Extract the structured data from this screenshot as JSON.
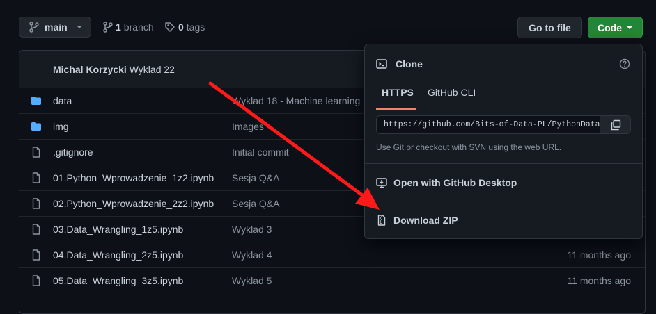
{
  "toolbar": {
    "branch_name": "main",
    "branch_count": "1",
    "branch_label": "branch",
    "tag_count": "0",
    "tag_label": "tags",
    "goto_file": "Go to file",
    "code_label": "Code"
  },
  "commit": {
    "author": "Michal Korzycki",
    "message": "Wyklad 22"
  },
  "files": [
    {
      "type": "folder",
      "name": "data",
      "message": "Wyklad 18 - Machine learning",
      "time": ""
    },
    {
      "type": "folder",
      "name": "img",
      "message": "Images",
      "time": ""
    },
    {
      "type": "file",
      "name": ".gitignore",
      "message": "Initial commit",
      "time": ""
    },
    {
      "type": "file",
      "name": "01.Python_Wprowadzenie_1z2.ipynb",
      "message": "Sesja Q&A",
      "time": ""
    },
    {
      "type": "file",
      "name": "02.Python_Wprowadzenie_2z2.ipynb",
      "message": "Sesja Q&A",
      "time": ""
    },
    {
      "type": "file",
      "name": "03.Data_Wrangling_1z5.ipynb",
      "message": "Wyklad 3",
      "time": ""
    },
    {
      "type": "file",
      "name": "04.Data_Wrangling_2z5.ipynb",
      "message": "Wyklad 4",
      "time": "11 months ago"
    },
    {
      "type": "file",
      "name": "05.Data_Wrangling_3z5.ipynb",
      "message": "Wyklad 5",
      "time": "11 months ago"
    }
  ],
  "clone_menu": {
    "title": "Clone",
    "tabs": [
      "HTTPS",
      "GitHub CLI"
    ],
    "url": "https://github.com/Bits-of-Data-PL/PythonData",
    "hint": "Use Git or checkout with SVN using the web URL.",
    "open_desktop": "Open with GitHub Desktop",
    "download_zip": "Download ZIP"
  },
  "colors": {
    "arrow": "#ff1a1a",
    "accent_green": "#238636",
    "folder_blue": "#54aeff",
    "tab_underline": "#f78166"
  }
}
